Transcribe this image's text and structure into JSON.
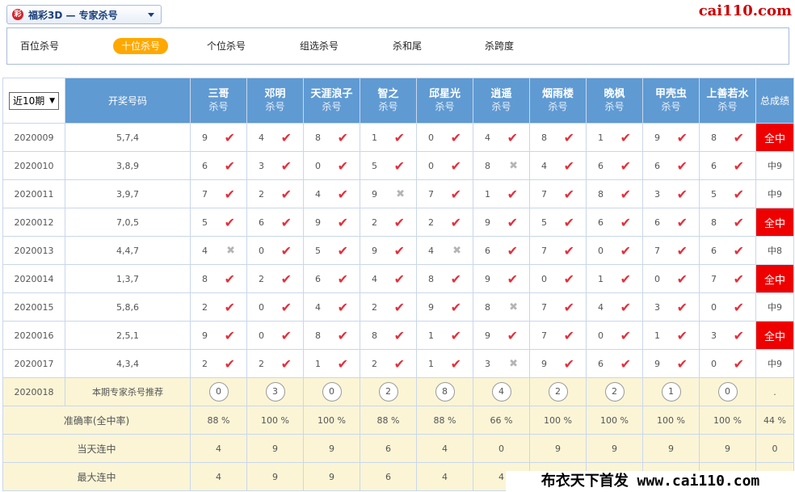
{
  "header": {
    "lottery_select": "福彩3D — 专家杀号",
    "site_logo": "cai110.com"
  },
  "tabs": [
    {
      "label": "百位杀号",
      "active": false
    },
    {
      "label": "十位杀号",
      "active": true
    },
    {
      "label": "个位杀号",
      "active": false
    },
    {
      "label": "组选杀号",
      "active": false
    },
    {
      "label": "杀和尾",
      "active": false
    },
    {
      "label": "杀跨度",
      "active": false
    }
  ],
  "table": {
    "period_select": "近10期",
    "draw_header": "开奖号码",
    "expert_sub": "杀号",
    "total_header": "总成绩",
    "experts": [
      "三哥",
      "邓明",
      "天涯浪子",
      "智之",
      "邱星光",
      "逍遥",
      "烟雨楼",
      "晚枫",
      "甲壳虫",
      "上善若水"
    ],
    "rows": [
      {
        "period": "2020009",
        "draw": "5,7,4",
        "kills": [
          [
            9,
            true
          ],
          [
            4,
            true
          ],
          [
            8,
            true
          ],
          [
            1,
            true
          ],
          [
            0,
            true
          ],
          [
            4,
            true
          ],
          [
            8,
            true
          ],
          [
            1,
            true
          ],
          [
            9,
            true
          ],
          [
            8,
            true
          ]
        ],
        "result": "全中",
        "full": true
      },
      {
        "period": "2020010",
        "draw": "3,8,9",
        "kills": [
          [
            6,
            true
          ],
          [
            3,
            true
          ],
          [
            0,
            true
          ],
          [
            5,
            true
          ],
          [
            0,
            true
          ],
          [
            8,
            false
          ],
          [
            4,
            true
          ],
          [
            6,
            true
          ],
          [
            6,
            true
          ],
          [
            6,
            true
          ]
        ],
        "result": "中9",
        "full": false
      },
      {
        "period": "2020011",
        "draw": "3,9,7",
        "kills": [
          [
            7,
            true
          ],
          [
            2,
            true
          ],
          [
            4,
            true
          ],
          [
            9,
            false
          ],
          [
            7,
            true
          ],
          [
            1,
            true
          ],
          [
            7,
            true
          ],
          [
            8,
            true
          ],
          [
            3,
            true
          ],
          [
            5,
            true
          ]
        ],
        "result": "中9",
        "full": false
      },
      {
        "period": "2020012",
        "draw": "7,0,5",
        "kills": [
          [
            5,
            true
          ],
          [
            6,
            true
          ],
          [
            9,
            true
          ],
          [
            2,
            true
          ],
          [
            2,
            true
          ],
          [
            9,
            true
          ],
          [
            5,
            true
          ],
          [
            6,
            true
          ],
          [
            6,
            true
          ],
          [
            8,
            true
          ]
        ],
        "result": "全中",
        "full": true
      },
      {
        "period": "2020013",
        "draw": "4,4,7",
        "kills": [
          [
            4,
            false
          ],
          [
            0,
            true
          ],
          [
            5,
            true
          ],
          [
            9,
            true
          ],
          [
            4,
            false
          ],
          [
            6,
            true
          ],
          [
            7,
            true
          ],
          [
            0,
            true
          ],
          [
            7,
            true
          ],
          [
            6,
            true
          ]
        ],
        "result": "中8",
        "full": false
      },
      {
        "period": "2020014",
        "draw": "1,3,7",
        "kills": [
          [
            8,
            true
          ],
          [
            2,
            true
          ],
          [
            6,
            true
          ],
          [
            4,
            true
          ],
          [
            8,
            true
          ],
          [
            9,
            true
          ],
          [
            0,
            true
          ],
          [
            1,
            true
          ],
          [
            0,
            true
          ],
          [
            7,
            true
          ]
        ],
        "result": "全中",
        "full": true
      },
      {
        "period": "2020015",
        "draw": "5,8,6",
        "kills": [
          [
            2,
            true
          ],
          [
            0,
            true
          ],
          [
            4,
            true
          ],
          [
            2,
            true
          ],
          [
            9,
            true
          ],
          [
            8,
            false
          ],
          [
            7,
            true
          ],
          [
            4,
            true
          ],
          [
            3,
            true
          ],
          [
            0,
            true
          ]
        ],
        "result": "中9",
        "full": false
      },
      {
        "period": "2020016",
        "draw": "2,5,1",
        "kills": [
          [
            9,
            true
          ],
          [
            0,
            true
          ],
          [
            8,
            true
          ],
          [
            8,
            true
          ],
          [
            1,
            true
          ],
          [
            9,
            true
          ],
          [
            7,
            true
          ],
          [
            0,
            true
          ],
          [
            1,
            true
          ],
          [
            3,
            true
          ]
        ],
        "result": "全中",
        "full": true
      },
      {
        "period": "2020017",
        "draw": "4,3,4",
        "kills": [
          [
            2,
            true
          ],
          [
            2,
            true
          ],
          [
            1,
            true
          ],
          [
            2,
            true
          ],
          [
            1,
            true
          ],
          [
            3,
            false
          ],
          [
            9,
            true
          ],
          [
            6,
            true
          ],
          [
            9,
            true
          ],
          [
            0,
            true
          ]
        ],
        "result": "中9",
        "full": false
      }
    ],
    "recommend": {
      "period": "2020018",
      "label": "本期专家杀号推荐",
      "values": [
        "0",
        "3",
        "0",
        "2",
        "8",
        "4",
        "2",
        "2",
        "1",
        "0"
      ],
      "total": "."
    },
    "stats": [
      {
        "label": "准确率(全中率)",
        "values": [
          "88 %",
          "100 %",
          "100 %",
          "88 %",
          "88 %",
          "66 %",
          "100 %",
          "100 %",
          "100 %",
          "100 %"
        ],
        "total": "44 %"
      },
      {
        "label": "当天连中",
        "values": [
          "4",
          "9",
          "9",
          "6",
          "4",
          "0",
          "9",
          "9",
          "9",
          "9"
        ],
        "total": "0"
      },
      {
        "label": "最大连中",
        "values": [
          "4",
          "9",
          "9",
          "6",
          "4",
          "4",
          "",
          "",
          "",
          "",
          ""
        ],
        "total": ""
      }
    ]
  },
  "watermark": "布衣天下首发 www.cai110.com",
  "icons": {
    "hit": "check-icon",
    "miss": "cross-icon"
  },
  "colors": {
    "header_bg": "#5f9ad3",
    "hit": "#e3303c",
    "full_result_bg": "#ee0000",
    "tab_active": "#ffa800",
    "stat_bg": "#fbf5d6"
  }
}
